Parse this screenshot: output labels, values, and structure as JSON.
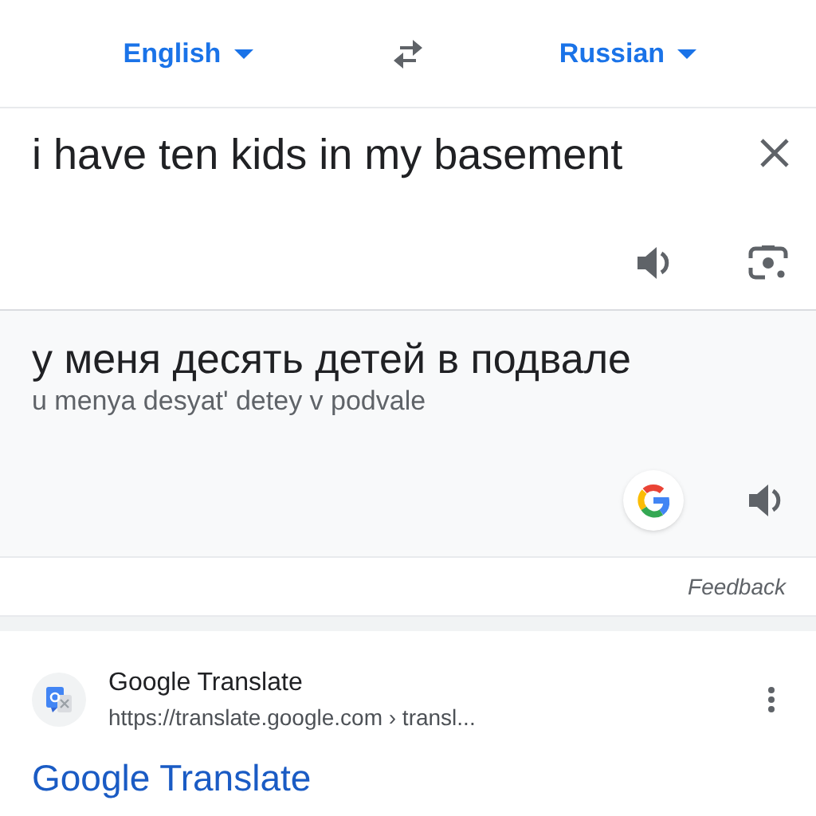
{
  "languages": {
    "source": "English",
    "target": "Russian"
  },
  "input": {
    "value": "i have ten kids in my basement"
  },
  "output": {
    "translation": "у меня десять детей в подвале",
    "transliteration": "u menya desyat' detey v podvale"
  },
  "feedback": "Feedback",
  "result": {
    "site_name": "Google Translate",
    "url": "https://translate.google.com › transl...",
    "title": "Google Translate"
  }
}
